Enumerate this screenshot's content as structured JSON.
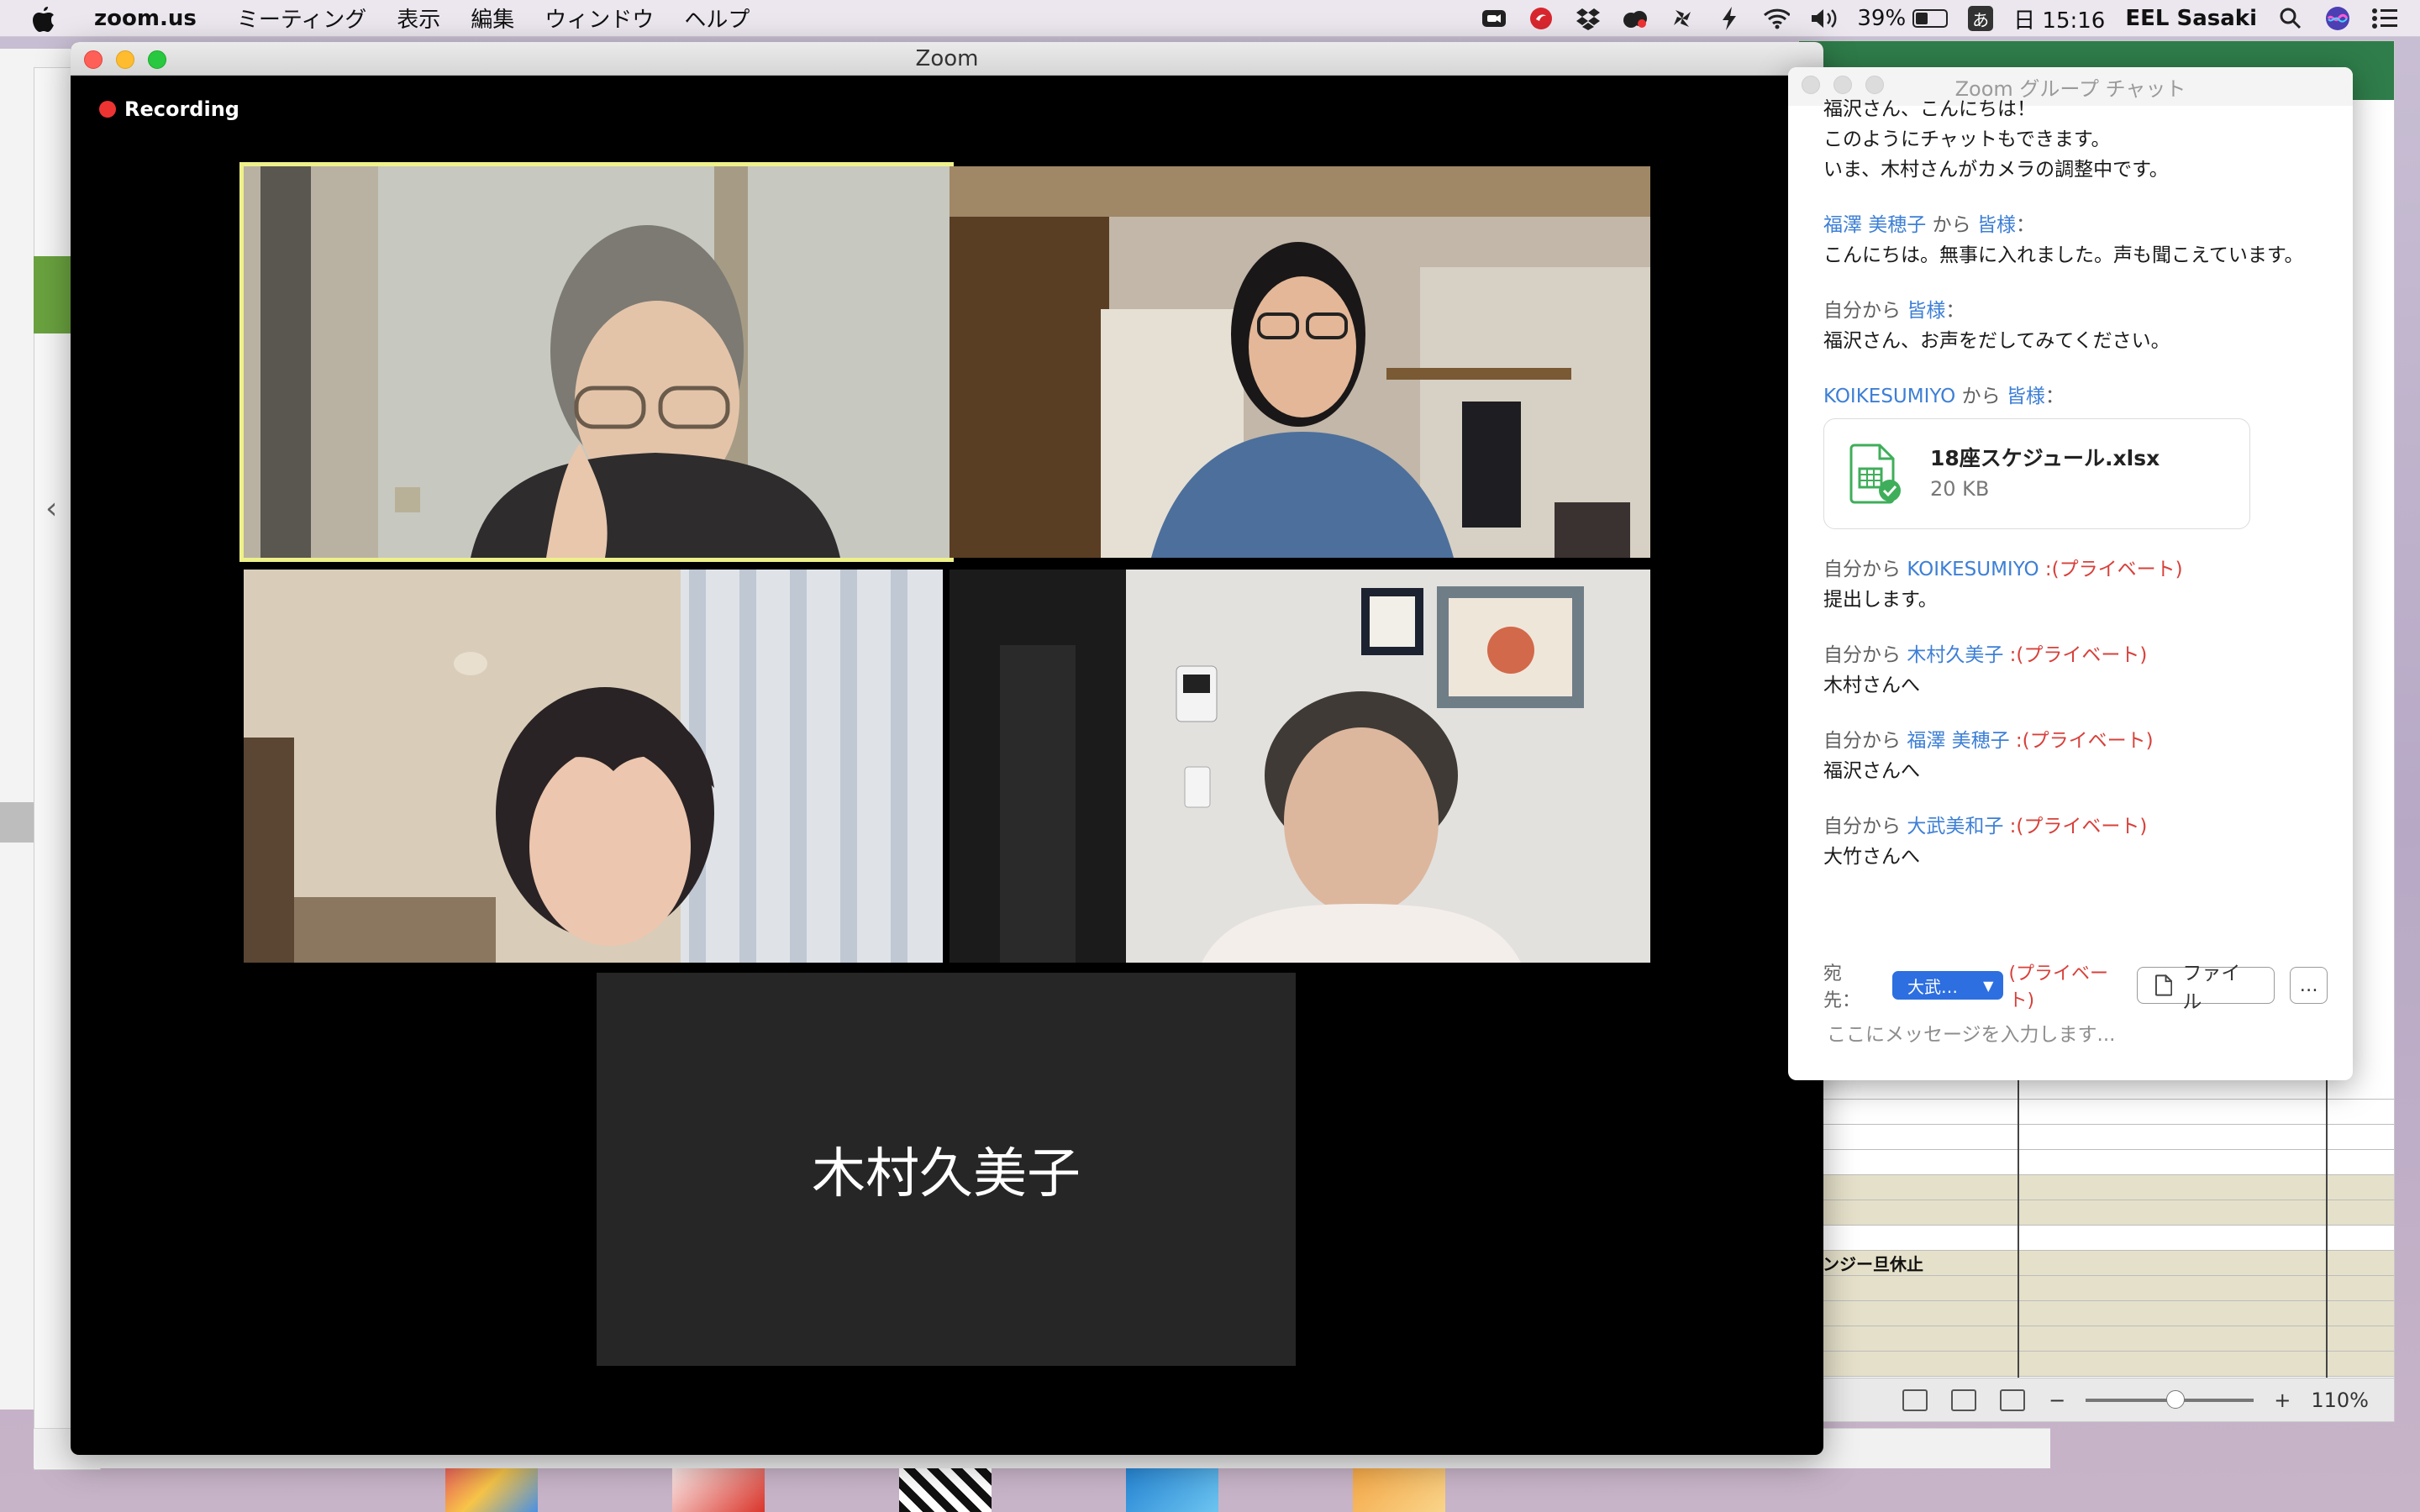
{
  "menubar": {
    "app_name": "zoom.us",
    "items": [
      "ミーティング",
      "表示",
      "編集",
      "ウィンドウ",
      "ヘルプ"
    ],
    "battery_percent": "39%",
    "ime": "あ",
    "clock": "日 15:16",
    "user": "EEL Sasaki"
  },
  "zoom_window": {
    "title": "Zoom",
    "recording_label": "Recording",
    "name_only_participant": "木村久美子"
  },
  "chat": {
    "title": "Zoom グループ チャット",
    "messages": [
      {
        "lines": [
          "福沢さん、こんにちは！",
          "このようにチャットもできます。",
          "いま、木村さんがカメラの調整中です。"
        ]
      },
      {
        "sender": "福澤 美穂子",
        "from": " から ",
        "to": "皆様",
        "colon": "：",
        "text": "こんにちは。無事に入れました。声も聞こえています。"
      },
      {
        "sender": "自分から ",
        "to": "皆様",
        "colon": "：",
        "text": "福沢さん、お声をだしてみてください。"
      },
      {
        "sender": "KOIKESUMIYO",
        "from": " から ",
        "to": "皆様",
        "colon": "：",
        "file": {
          "name": "18座スケジュール.xlsx",
          "size": "20 KB"
        }
      },
      {
        "sender": "自分から ",
        "to": "KOIKESUMIYO",
        "private": " :(プライベート)",
        "text": "提出します。"
      },
      {
        "sender": "自分から ",
        "to": "木村久美子",
        "private": " :(プライベート)",
        "text": "木村さんへ"
      },
      {
        "sender": "自分から ",
        "to": "福澤 美穂子",
        "private": " :(プライベート)",
        "text": "福沢さんへ"
      },
      {
        "sender": "自分から ",
        "to": "大武美和子",
        "private": " :(プライベート)",
        "text": "大竹さんへ"
      }
    ],
    "footer": {
      "to_label": "宛先：",
      "recipient": "大武…",
      "private_label": "(プライベート)",
      "file_button": "ファイル",
      "more_button": "…",
      "input_placeholder": "ここにメッセージを入力します..."
    }
  },
  "excel": {
    "cell_text": "ンジー旦休止",
    "zoom_level": "110%"
  }
}
